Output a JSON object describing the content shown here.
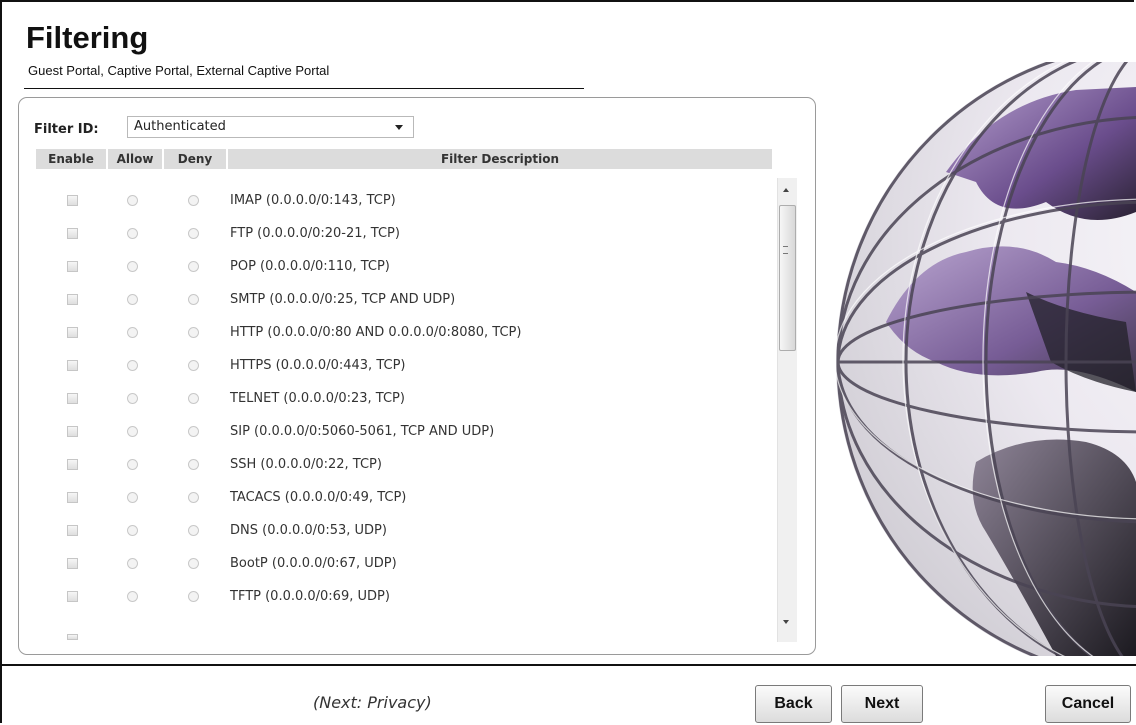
{
  "page": {
    "title": "Filtering",
    "subtitle": "Guest Portal, Captive Portal, External Captive Portal"
  },
  "filter": {
    "label": "Filter ID:",
    "selected": "Authenticated"
  },
  "table": {
    "headers": [
      "Enable",
      "Allow",
      "Deny",
      "Filter Description"
    ],
    "rows": [
      {
        "description": "IMAP (0.0.0.0/0:143, TCP)"
      },
      {
        "description": "FTP (0.0.0.0/0:20-21, TCP)"
      },
      {
        "description": "POP (0.0.0.0/0:110, TCP)"
      },
      {
        "description": "SMTP (0.0.0.0/0:25, TCP AND UDP)"
      },
      {
        "description": "HTTP (0.0.0.0/0:80 AND 0.0.0.0/0:8080, TCP)"
      },
      {
        "description": "HTTPS (0.0.0.0/0:443, TCP)"
      },
      {
        "description": "TELNET (0.0.0.0/0:23, TCP)"
      },
      {
        "description": "SIP (0.0.0.0/0:5060-5061, TCP AND UDP)"
      },
      {
        "description": "SSH (0.0.0.0/0:22, TCP)"
      },
      {
        "description": "TACACS (0.0.0.0/0:49, TCP)"
      },
      {
        "description": "DNS (0.0.0.0/0:53, UDP)"
      },
      {
        "description": "BootP (0.0.0.0/0:67, UDP)"
      },
      {
        "description": "TFTP (0.0.0.0/0:69, UDP)"
      }
    ]
  },
  "footer": {
    "next_hint": "(Next: Privacy)",
    "back_label": "Back",
    "next_label": "Next",
    "cancel_label": "Cancel"
  },
  "icons": {
    "decoration": "globe-icon",
    "scroll_up": "scroll-up-icon",
    "scroll_down": "scroll-down-icon",
    "dropdown": "chevron-down-icon"
  },
  "colors": {
    "globe_purple": "#8a6aa8",
    "header_bg": "#dcdcdc"
  }
}
